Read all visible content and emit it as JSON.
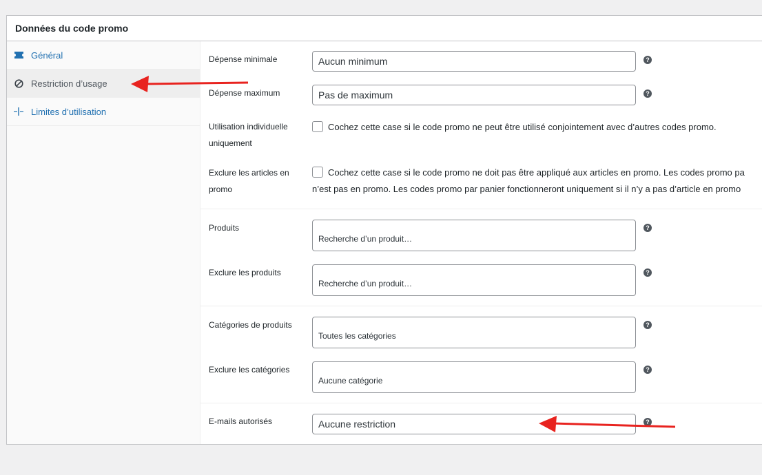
{
  "panel": {
    "title": "Données du code promo"
  },
  "tabs": [
    {
      "label": "Général",
      "icon": "ticket-icon"
    },
    {
      "label": "Restriction d’usage",
      "icon": "prohibited-icon"
    },
    {
      "label": "Limites d’utilisation",
      "icon": "limits-icon"
    }
  ],
  "fields": {
    "min_spend": {
      "label": "Dépense minimale",
      "placeholder": "Aucun minimum"
    },
    "max_spend": {
      "label": "Dépense maximum",
      "placeholder": "Pas de maximum"
    },
    "individual_use": {
      "label": "Utilisation individuelle uniquement",
      "text": "Cochez cette case si le code promo ne peut être utilisé conjointement avec d’autres codes promo."
    },
    "exclude_sale": {
      "label": "Exclure les articles en promo",
      "text_line1": "Cochez cette case si le code promo ne doit pas être appliqué aux articles en promo. Les codes promo pa",
      "text_line2": "n’est pas en promo. Les codes promo par panier fonctionneront uniquement si il n’y a pas d’article en promo"
    },
    "products": {
      "label": "Produits",
      "placeholder": "Recherche d’un produit…"
    },
    "exclude_products": {
      "label": "Exclure les produits",
      "placeholder": "Recherche d’un produit…"
    },
    "categories": {
      "label": "Catégories de produits",
      "placeholder": "Toutes les catégories"
    },
    "exclude_categories": {
      "label": "Exclure les catégories",
      "placeholder": "Aucune catégorie"
    },
    "emails": {
      "label": "E-mails autorisés",
      "placeholder": "Aucune restriction"
    }
  },
  "help_icon": "question-icon",
  "colors": {
    "link": "#2271b1",
    "arrow": "#e8231f",
    "help": "#50575e"
  }
}
